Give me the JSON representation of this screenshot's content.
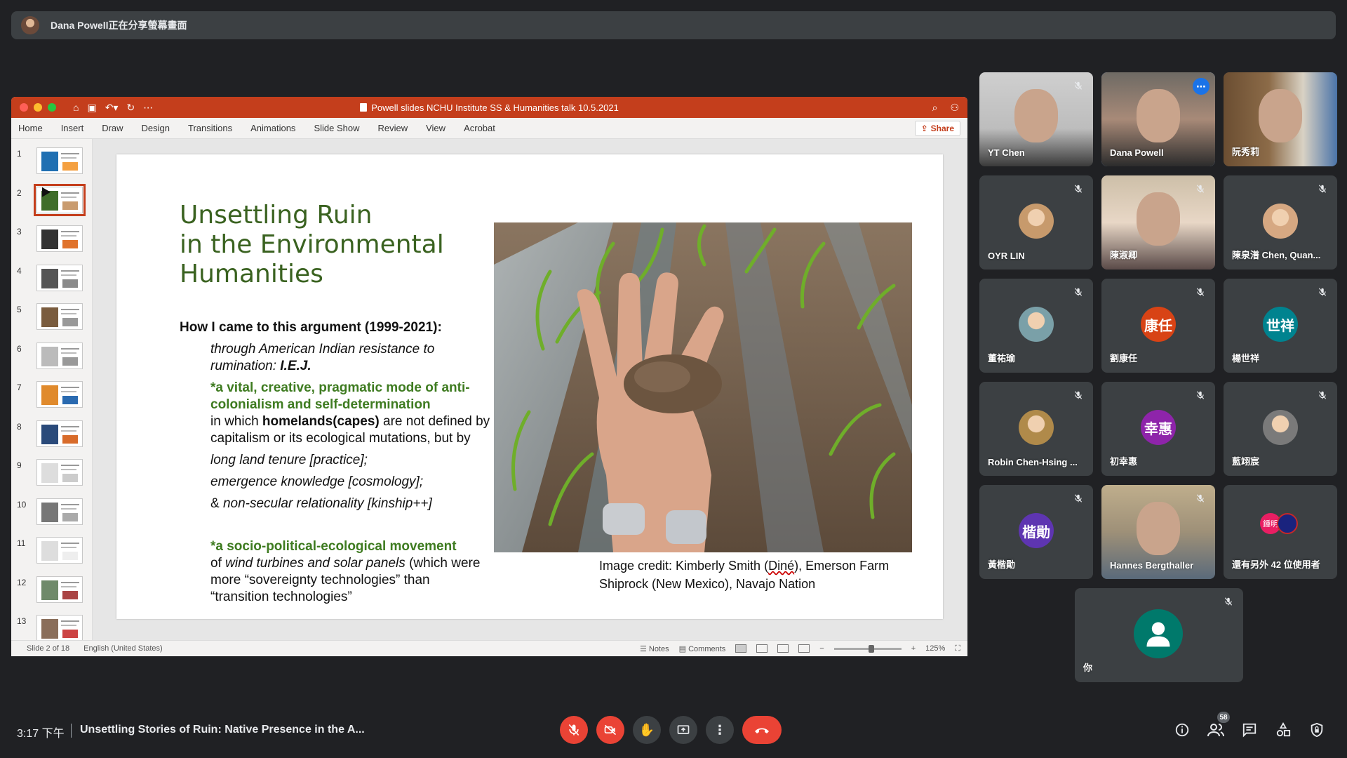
{
  "presenting_banner": {
    "text": "Dana Powell正在分享螢幕畫面"
  },
  "ppt": {
    "document_title": "Powell slides NCHU Institute SS & Humanities talk 10.5.2021",
    "ribbon_tabs": [
      "Home",
      "Insert",
      "Draw",
      "Design",
      "Transitions",
      "Animations",
      "Slide Show",
      "Review",
      "View",
      "Acrobat"
    ],
    "share_label": "Share",
    "thumbnails": [
      "1",
      "2",
      "3",
      "4",
      "5",
      "6",
      "7",
      "8",
      "9",
      "10",
      "11",
      "12",
      "13"
    ],
    "active_slide": 2,
    "status": {
      "slide_counter": "Slide 2 of 18",
      "language": "English (United States)",
      "notes_label": "Notes",
      "comments_label": "Comments",
      "zoom": "125%",
      "zoom_slider_value": 0.55
    }
  },
  "slide": {
    "title_lines": [
      "Unsettling Ruin",
      "in the Environmental",
      "Humanities"
    ],
    "heading": "How I came to this argument (1999-2021):",
    "b1_italic": "through American Indian resistance to rumination: ",
    "b1_bold": "I.E.J.",
    "b2_green": "*a vital, creative, pragmatic mode of anti-colonialism and self-determination",
    "b3_pre": "in which ",
    "b3_bold": "homelands(capes)",
    "b3_post": " are not defined by capitalism or its ecological mutations, but by",
    "b4": "long land tenure [practice];",
    "b5": "emergence knowledge [cosmology];",
    "b6_pre": "& ",
    "b6_italic": "non-secular relationality [kinship++]",
    "b7_green": "*a socio-political-ecological movement",
    "b7_pre": "of ",
    "b7_italic": "wind turbines and solar panels",
    "b7_post": " (which were more “sovereignty technologies” than “transition technologies”",
    "credit_pre": "Image credit: Kimberly Smith (",
    "credit_dine": "Diné",
    "credit_post": "), Emerson Farm Shiprock (New Mexico), Navajo Nation"
  },
  "participants": [
    {
      "name": "YT Chen",
      "muted": true
    },
    {
      "name": "Dana Powell",
      "muted": false,
      "speaking": true
    },
    {
      "name": "阮秀莉",
      "muted": false
    },
    {
      "name": "OYR LIN",
      "muted": true
    },
    {
      "name": "陳淑卿",
      "muted": true
    },
    {
      "name": "陳泉潽 Chen, Quan...",
      "muted": true
    },
    {
      "name": "董祐瑜",
      "muted": true
    },
    {
      "name": "劉康任",
      "muted": true,
      "initials": "康任",
      "color": "#d84315"
    },
    {
      "name": "楊世祥",
      "muted": true,
      "initials": "世祥",
      "color": "#00838f"
    },
    {
      "name": "Robin Chen-Hsing ...",
      "muted": true
    },
    {
      "name": "初幸惠",
      "muted": true,
      "initials": "幸惠",
      "color": "#8e24aa"
    },
    {
      "name": "藍翊宸",
      "muted": true
    },
    {
      "name": "黃楷勛",
      "muted": true,
      "initials": "楷勛",
      "color": "#5e35b1"
    },
    {
      "name": "Hannes Bergthaller",
      "muted": true
    },
    {
      "name": "還有另外 42 位使用者",
      "muted": false,
      "mini": "鍾明"
    },
    {
      "name": "你",
      "muted": true
    }
  ],
  "bottom_bar": {
    "time": "3:17 下午",
    "meeting_title": "Unsettling Stories of Ruin: Native Presence in the A...",
    "people_count": "58"
  },
  "colors": {
    "ppt_accent": "#c43e1c",
    "meet_bg": "#202124",
    "end_call": "#ea4335",
    "speaking": "#8ab4f8"
  }
}
